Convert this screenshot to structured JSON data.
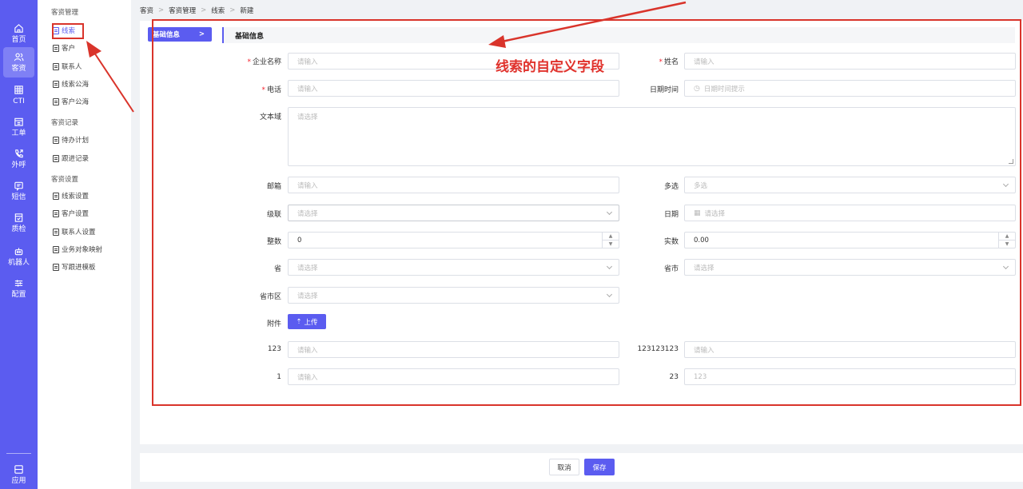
{
  "rail": {
    "items": [
      {
        "label": "首页",
        "icon": "home-icon"
      },
      {
        "label": "客资",
        "icon": "users-icon"
      },
      {
        "label": "CTI",
        "icon": "grid-icon"
      },
      {
        "label": "工单",
        "icon": "calendar-icon"
      },
      {
        "label": "外呼",
        "icon": "phone-icon"
      },
      {
        "label": "短信",
        "icon": "message-icon"
      },
      {
        "label": "质检",
        "icon": "clipboard-icon"
      },
      {
        "label": "机器人",
        "icon": "robot-icon"
      },
      {
        "label": "配置",
        "icon": "sliders-icon"
      }
    ],
    "bottom": {
      "label": "应用",
      "icon": "app-icon"
    },
    "accent": "#5b5cf0"
  },
  "submenu": {
    "groups": [
      {
        "title": "客资管理",
        "items": [
          "线索",
          "客户",
          "联系人",
          "线索公海",
          "客户公海"
        ]
      },
      {
        "title": "客资记录",
        "items": [
          "待办计划",
          "跟进记录"
        ]
      },
      {
        "title": "客资设置",
        "items": [
          "线索设置",
          "客户设置",
          "联系人设置",
          "业务对象映射",
          "写跟进模板"
        ]
      }
    ]
  },
  "breadcrumb": [
    "客资",
    "客资管理",
    "线索",
    "新建"
  ],
  "sidetab": {
    "label": "基础信息",
    "arrow": ">"
  },
  "section": {
    "title": "基础信息"
  },
  "form": {
    "company_name": {
      "label": "企业名称",
      "placeholder": "请输入"
    },
    "name": {
      "label": "姓名",
      "placeholder": "请输入"
    },
    "phone": {
      "label": "电话",
      "placeholder": "请输入"
    },
    "datetime": {
      "label": "日期时间",
      "placeholder": "日期时间提示"
    },
    "textarea": {
      "label": "文本域",
      "placeholder": "请选择"
    },
    "email": {
      "label": "邮箱",
      "placeholder": "请输入"
    },
    "multi": {
      "label": "多选",
      "placeholder": "多选"
    },
    "cascade": {
      "label": "级联",
      "placeholder": "请选择"
    },
    "date": {
      "label": "日期",
      "placeholder": "请选择"
    },
    "integer": {
      "label": "整数",
      "value": "0"
    },
    "decimal": {
      "label": "实数",
      "value": "0.00"
    },
    "province": {
      "label": "省",
      "placeholder": "请选择"
    },
    "province_city": {
      "label": "省市",
      "placeholder": "请选择"
    },
    "province_city_district": {
      "label": "省市区",
      "placeholder": "请选择"
    },
    "attachment": {
      "label": "附件",
      "button": "上传"
    },
    "f123": {
      "label": "123",
      "placeholder": "请输入"
    },
    "f123123123": {
      "label": "123123123",
      "placeholder": "请输入"
    },
    "f1": {
      "label": "1",
      "placeholder": "请输入"
    },
    "f23": {
      "label": "23",
      "placeholder": "123"
    }
  },
  "annotation": {
    "text": "线索的自定义字段",
    "color": "#d9342b"
  },
  "footer": {
    "cancel": "取消",
    "save": "保存"
  }
}
